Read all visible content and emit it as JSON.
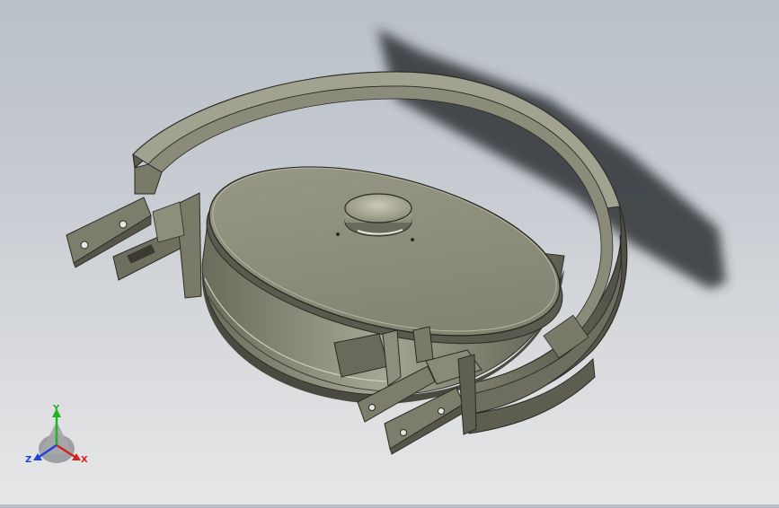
{
  "viewport": {
    "background_top": "#b9c0c8",
    "background_bottom": "#e6e7e8",
    "model_color": "#8c8c7a",
    "model_edge_color": "#2b2b26",
    "shadow_color": "#2e3236"
  },
  "triad": {
    "x_label": "X",
    "y_label": "Y",
    "z_label": "Z",
    "x_color": "#d6221c",
    "y_color": "#22b422",
    "z_color": "#2442d8",
    "icon": "coordinate-triad-icon"
  }
}
